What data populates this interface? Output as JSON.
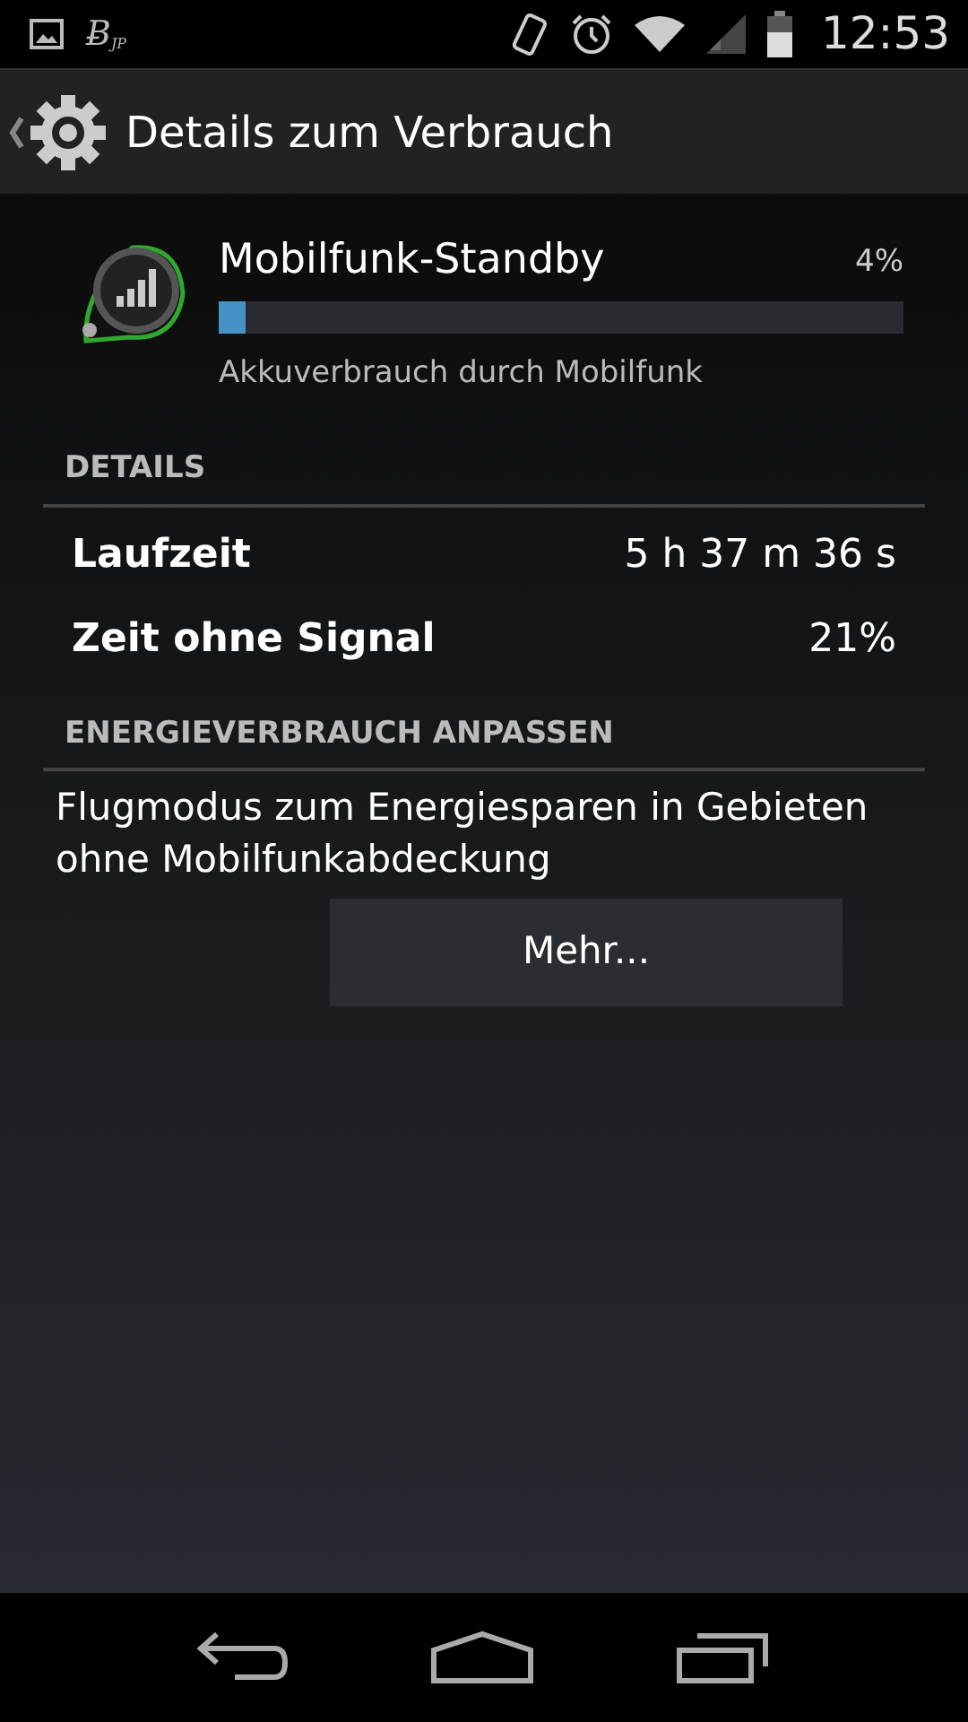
{
  "status_bar": {
    "notification_mark": "Ƀ$_{JP}$",
    "time": "12:53"
  },
  "action_bar": {
    "title": "Details zum Verbrauch"
  },
  "usage": {
    "name": "Mobilfunk-Standby",
    "percent": "4%",
    "level": 0.04,
    "description": "Akkuverbrauch durch Mobilfunk"
  },
  "sections": [
    {
      "header": "DETAILS",
      "rows": [
        {
          "label": "Laufzeit",
          "value": "5 h 37 m 36 s"
        },
        {
          "label": "Zeit ohne Signal",
          "value": "21%"
        }
      ]
    },
    {
      "header": "ENERGIEVERBRAUCH ANPASSEN",
      "text": "Flugmodus zum Energiesparen in Gebieten ohne Mobilfunkabdeckung",
      "button": "Mehr..."
    }
  ]
}
